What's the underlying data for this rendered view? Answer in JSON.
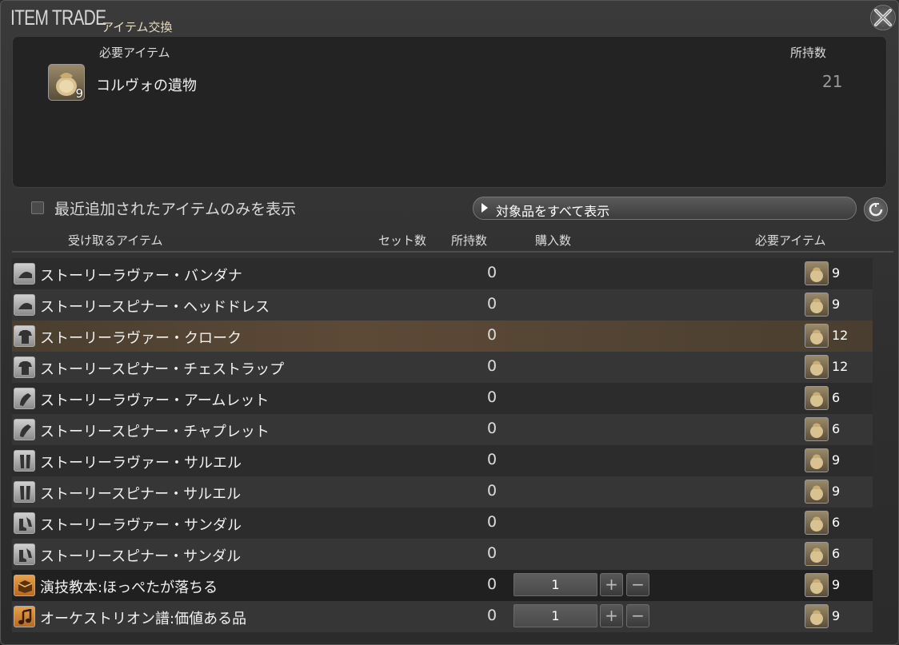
{
  "window": {
    "title": "ITEM TRADE",
    "subtitle": "アイテム交換"
  },
  "required_panel": {
    "col_item": "必要アイテム",
    "col_owned": "所持数",
    "item_name": "コルヴォの遺物",
    "item_icon_count": "9",
    "owned": "21",
    "item_icon": "bag-icon"
  },
  "filters": {
    "recent_only_label": "最近追加されたアイテムのみを表示",
    "recent_only_checked": false,
    "dropdown_label": "対象品をすべて表示"
  },
  "table": {
    "headers": {
      "receive": "受け取るアイテム",
      "sets": "セット数",
      "owned": "所持数",
      "purchase": "購入数",
      "required": "必要アイテム"
    },
    "rows": [
      {
        "name": "ストーリーラヴァー・バンダナ",
        "owned": "0",
        "cost": "9",
        "icon": "head-icon"
      },
      {
        "name": "ストーリースピナー・ヘッドドレス",
        "owned": "0",
        "cost": "9",
        "icon": "head-icon"
      },
      {
        "name": "ストーリーラヴァー・クローク",
        "owned": "0",
        "cost": "12",
        "icon": "body-icon"
      },
      {
        "name": "ストーリースピナー・チェストラップ",
        "owned": "0",
        "cost": "12",
        "icon": "body-icon"
      },
      {
        "name": "ストーリーラヴァー・アームレット",
        "owned": "0",
        "cost": "6",
        "icon": "hands-icon"
      },
      {
        "name": "ストーリースピナー・チャプレット",
        "owned": "0",
        "cost": "6",
        "icon": "hands-icon"
      },
      {
        "name": "ストーリーラヴァー・サルエル",
        "owned": "0",
        "cost": "9",
        "icon": "legs-icon"
      },
      {
        "name": "ストーリースピナー・サルエル",
        "owned": "0",
        "cost": "9",
        "icon": "legs-icon"
      },
      {
        "name": "ストーリーラヴァー・サンダル",
        "owned": "0",
        "cost": "6",
        "icon": "feet-icon"
      },
      {
        "name": "ストーリースピナー・サンダル",
        "owned": "0",
        "cost": "6",
        "icon": "feet-icon"
      },
      {
        "name": "演技教本:ほっぺたが落ちる",
        "owned": "0",
        "cost": "9",
        "qty": "1",
        "icon": "book-icon"
      },
      {
        "name": "オーケストリオン譜:価値ある品",
        "owned": "0",
        "cost": "9",
        "qty": "1",
        "icon": "music-note-icon"
      }
    ]
  },
  "colors": {
    "selected_row": "#5c4a36",
    "accent_text": "#e6dcc0"
  }
}
